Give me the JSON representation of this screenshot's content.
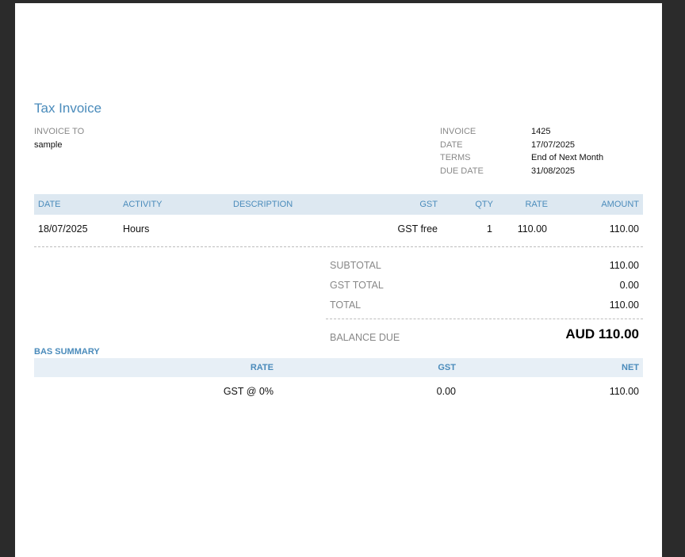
{
  "invoice": {
    "title": "Tax Invoice",
    "to_label": "INVOICE TO",
    "to_value": "sample",
    "meta": [
      {
        "label": "INVOICE",
        "value": "1425"
      },
      {
        "label": "DATE",
        "value": "17/07/2025"
      },
      {
        "label": "TERMS",
        "value": "End of Next Month"
      },
      {
        "label": "DUE DATE",
        "value": "31/08/2025"
      }
    ]
  },
  "items_table": {
    "headers": {
      "date": "DATE",
      "activity": "ACTIVITY",
      "description": "DESCRIPTION",
      "gst": "GST",
      "qty": "QTY",
      "rate": "RATE",
      "amount": "AMOUNT"
    },
    "rows": [
      {
        "date": "18/07/2025",
        "activity": "Hours",
        "description": "",
        "gst": "GST free",
        "qty": "1",
        "rate": "110.00",
        "amount": "110.00"
      }
    ]
  },
  "totals": {
    "subtotal_label": "SUBTOTAL",
    "subtotal_value": "110.00",
    "gst_total_label": "GST TOTAL",
    "gst_total_value": "0.00",
    "total_label": "TOTAL",
    "total_value": "110.00",
    "balance_label": "BALANCE DUE",
    "balance_value": "AUD 110.00"
  },
  "bas_summary": {
    "title": "BAS SUMMARY",
    "headers": {
      "rate": "RATE",
      "gst": "GST",
      "net": "NET"
    },
    "rows": [
      {
        "rate": "GST @ 0%",
        "gst": "0.00",
        "net": "110.00"
      }
    ]
  },
  "colors": {
    "accent": "#4a8bbb",
    "header_band": "#dde8f1",
    "backdrop": "#2b2b2b"
  }
}
